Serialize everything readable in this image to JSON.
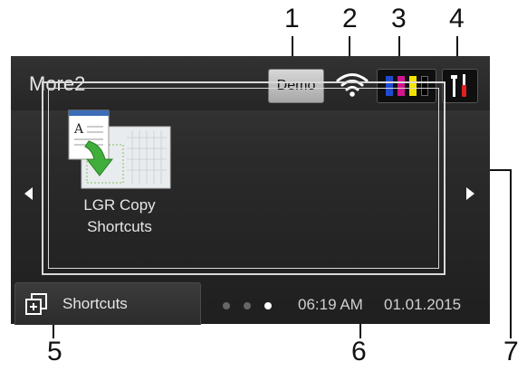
{
  "callouts": [
    "1",
    "2",
    "3",
    "4",
    "5",
    "6",
    "7"
  ],
  "screen": {
    "title": "More2",
    "demo_label": "Demo",
    "ink_colors": [
      "#1f4bd1",
      "#d0168f",
      "#f4e300",
      "#000000"
    ],
    "shortcut": {
      "label_line1": "LGR Copy",
      "label_line2": "Shortcuts"
    },
    "shortcuts_tab_label": "Shortcuts",
    "time": "06:19 AM",
    "date": "01.01.2015"
  }
}
